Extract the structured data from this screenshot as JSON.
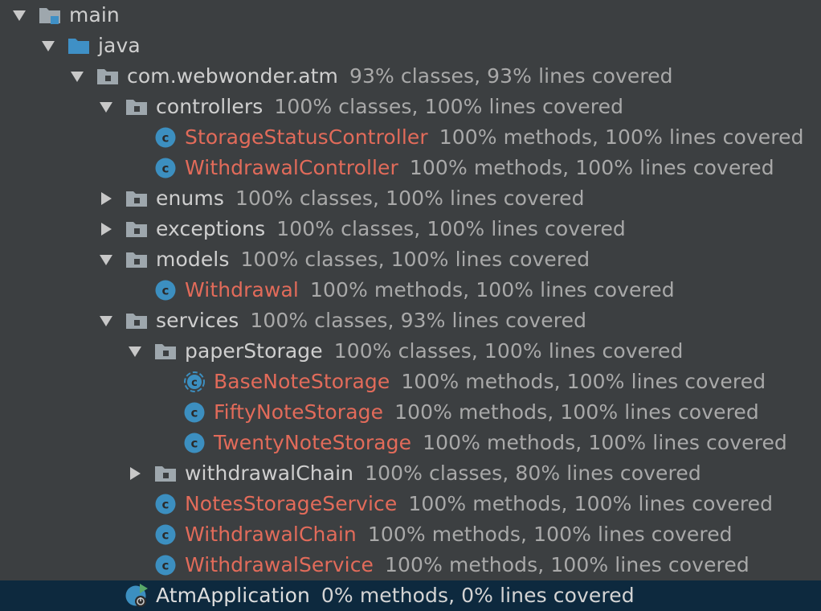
{
  "colors": {
    "background": "#3c3f41",
    "selection": "#0d293e",
    "class_name": "#e26b5a",
    "folder": "#9ea7ad",
    "source_folder": "#3f90c6",
    "class_icon": "#3c8fc0"
  },
  "tree": [
    {
      "id": "main",
      "depth": 0,
      "expand": "expanded",
      "icon": "module-folder-icon",
      "name": "main",
      "coverage": "",
      "kind": "folder"
    },
    {
      "id": "java",
      "depth": 1,
      "expand": "expanded",
      "icon": "source-folder-icon",
      "name": "java",
      "coverage": "",
      "kind": "folder"
    },
    {
      "id": "atm",
      "depth": 2,
      "expand": "expanded",
      "icon": "package-icon",
      "name": "com.webwonder.atm",
      "coverage": "93% classes, 93% lines covered",
      "kind": "folder"
    },
    {
      "id": "controllers",
      "depth": 3,
      "expand": "expanded",
      "icon": "package-icon",
      "name": "controllers",
      "coverage": "100% classes, 100% lines covered",
      "kind": "folder"
    },
    {
      "id": "storage-status-controller",
      "depth": 4,
      "expand": "none",
      "icon": "class-icon",
      "name": "StorageStatusController",
      "coverage": "100% methods, 100% lines covered",
      "kind": "class"
    },
    {
      "id": "withdrawal-controller",
      "depth": 4,
      "expand": "none",
      "icon": "class-icon",
      "name": "WithdrawalController",
      "coverage": "100% methods, 100% lines covered",
      "kind": "class"
    },
    {
      "id": "enums",
      "depth": 3,
      "expand": "collapsed",
      "icon": "package-icon",
      "name": "enums",
      "coverage": "100% classes, 100% lines covered",
      "kind": "folder"
    },
    {
      "id": "exceptions",
      "depth": 3,
      "expand": "collapsed",
      "icon": "package-icon",
      "name": "exceptions",
      "coverage": "100% classes, 100% lines covered",
      "kind": "folder"
    },
    {
      "id": "models",
      "depth": 3,
      "expand": "expanded",
      "icon": "package-icon",
      "name": "models",
      "coverage": "100% classes, 100% lines covered",
      "kind": "folder"
    },
    {
      "id": "withdrawal",
      "depth": 4,
      "expand": "none",
      "icon": "class-icon",
      "name": "Withdrawal",
      "coverage": "100% methods, 100% lines covered",
      "kind": "class"
    },
    {
      "id": "services",
      "depth": 3,
      "expand": "expanded",
      "icon": "package-icon",
      "name": "services",
      "coverage": "100% classes, 93% lines covered",
      "kind": "folder"
    },
    {
      "id": "paper-storage",
      "depth": 4,
      "expand": "expanded",
      "icon": "package-icon",
      "name": "paperStorage",
      "coverage": "100% classes, 100% lines covered",
      "kind": "folder"
    },
    {
      "id": "base-note-storage",
      "depth": 5,
      "expand": "none",
      "icon": "abstract-class-icon",
      "name": "BaseNoteStorage",
      "coverage": "100% methods, 100% lines covered",
      "kind": "class"
    },
    {
      "id": "fifty-note-storage",
      "depth": 5,
      "expand": "none",
      "icon": "class-icon",
      "name": "FiftyNoteStorage",
      "coverage": "100% methods, 100% lines covered",
      "kind": "class"
    },
    {
      "id": "twenty-note-storage",
      "depth": 5,
      "expand": "none",
      "icon": "class-icon",
      "name": "TwentyNoteStorage",
      "coverage": "100% methods, 100% lines covered",
      "kind": "class"
    },
    {
      "id": "withdrawal-chain-pkg",
      "depth": 4,
      "expand": "collapsed",
      "icon": "package-icon",
      "name": "withdrawalChain",
      "coverage": "100% classes, 80% lines covered",
      "kind": "folder"
    },
    {
      "id": "notes-storage-service",
      "depth": 4,
      "expand": "none",
      "icon": "class-icon",
      "name": "NotesStorageService",
      "coverage": "100% methods, 100% lines covered",
      "kind": "class"
    },
    {
      "id": "withdrawal-chain",
      "depth": 4,
      "expand": "none",
      "icon": "class-icon",
      "name": "WithdrawalChain",
      "coverage": "100% methods, 100% lines covered",
      "kind": "class"
    },
    {
      "id": "withdrawal-service",
      "depth": 4,
      "expand": "none",
      "icon": "class-icon",
      "name": "WithdrawalService",
      "coverage": "100% methods, 100% lines covered",
      "kind": "class"
    },
    {
      "id": "atm-application",
      "depth": 3,
      "expand": "none",
      "icon": "spring-boot-app-icon",
      "name": "AtmApplication",
      "coverage": "0% methods, 0% lines covered",
      "kind": "app",
      "selected": true
    }
  ]
}
